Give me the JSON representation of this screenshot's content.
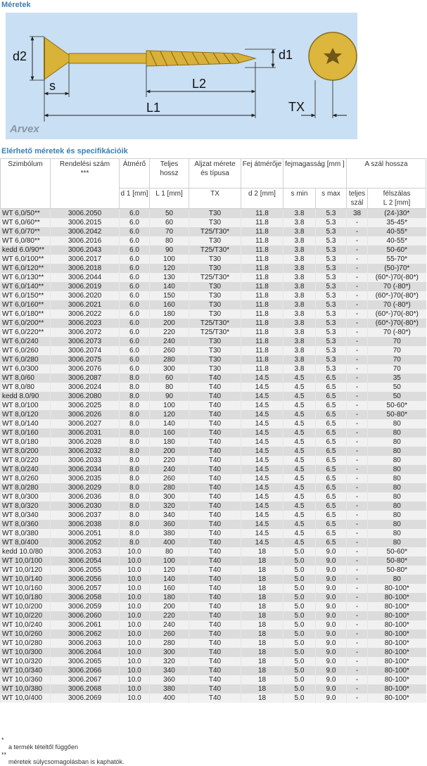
{
  "section_title": "Méretek",
  "spec_title": "Elérhető méretek és specifikációik",
  "diagram": {
    "labels": {
      "d2": "d2",
      "d1": "d1",
      "s": "s",
      "L2": "L2",
      "L1": "L1",
      "TX": "TX"
    },
    "brand": "Arvex"
  },
  "table": {
    "headers": {
      "symbol": "Szimbólum",
      "order": "Rendelési szám",
      "order_mark": "***",
      "diameter": "Átmérő",
      "length": "Teljes hossz",
      "socket": "Aljzat mérete és típusa",
      "head": "Fej átmérője",
      "head_height": "fejmagasság [mm ]",
      "thread": "A szál hossza",
      "full": "teljes szál",
      "partial": "félszálas",
      "d1": "d 1 [mm]",
      "l1": "L 1 [mm]",
      "tx": "TX",
      "d2": "d 2 [mm]",
      "smin": "s min",
      "smax": "s max",
      "l2": "L 2 [mm]"
    },
    "rows": [
      [
        "WT 6,0/50**",
        "3006.2050",
        "6.0",
        "50",
        "T30",
        "11.8",
        "3.8",
        "5.3",
        "38",
        "(24-)30*"
      ],
      [
        "WT 6,0/60**",
        "3006.2015",
        "6.0",
        "60",
        "T30",
        "11.8",
        "3.8",
        "5.3",
        "-",
        "35-45*"
      ],
      [
        "WT 6,0/70**",
        "3006.2042",
        "6.0",
        "70",
        "T25/T30*",
        "11.8",
        "3.8",
        "5.3",
        "-",
        "40-55*"
      ],
      [
        "WT 6,0/80**",
        "3006.2016",
        "6.0",
        "80",
        "T30",
        "11.8",
        "3.8",
        "5.3",
        "-",
        "40-55*"
      ],
      [
        "kedd 6.0/90**",
        "3006.2043",
        "6.0",
        "90",
        "T25/T30*",
        "11.8",
        "3.8",
        "5.3",
        "-",
        "50-60*"
      ],
      [
        "WT 6,0/100**",
        "3006.2017",
        "6.0",
        "100",
        "T30",
        "11.8",
        "3.8",
        "5.3",
        "-",
        "55-70*"
      ],
      [
        "WT 6,0/120**",
        "3006.2018",
        "6.0",
        "120",
        "T30",
        "11.8",
        "3.8",
        "5.3",
        "-",
        "(50-)70*"
      ],
      [
        "WT 6,0/130**",
        "3006.2044",
        "6.0",
        "130",
        "T25/T30*",
        "11.8",
        "3.8",
        "5.3",
        "-",
        "(60*-)70(-80*)"
      ],
      [
        "WT 6,0/140**",
        "3006.2019",
        "6.0",
        "140",
        "T30",
        "11.8",
        "3.8",
        "5.3",
        "-",
        "70 (-80*)"
      ],
      [
        "WT 6,0/150**",
        "3006.2020",
        "6.0",
        "150",
        "T30",
        "11.8",
        "3.8",
        "5.3",
        "-",
        "(60*-)70(-80*)"
      ],
      [
        "WT 6,0/160**",
        "3006.2021",
        "6.0",
        "160",
        "T30",
        "11.8",
        "3.8",
        "5.3",
        "-",
        "70 (-80*)"
      ],
      [
        "WT 6,0/180**",
        "3006.2022",
        "6.0",
        "180",
        "T30",
        "11.8",
        "3.8",
        "5.3",
        "-",
        "(60*-)70(-80*)"
      ],
      [
        "WT 6,0/200**",
        "3006.2023",
        "6.0",
        "200",
        "T25/T30*",
        "11.8",
        "3.8",
        "5.3",
        "-",
        "(60*-)70(-80*)"
      ],
      [
        "WT 6,0/220**",
        "3006.2072",
        "6.0",
        "220",
        "T25/T30*",
        "11.8",
        "3.8",
        "5.3",
        "-",
        "70 (-80*)"
      ],
      [
        "WT 6,0/240",
        "3006.2073",
        "6.0",
        "240",
        "T30",
        "11.8",
        "3.8",
        "5.3",
        "-",
        "70"
      ],
      [
        "WT 6,0/260",
        "3006.2074",
        "6.0",
        "260",
        "T30",
        "11.8",
        "3.8",
        "5.3",
        "-",
        "70"
      ],
      [
        "WT 6,0/280",
        "3006.2075",
        "6.0",
        "280",
        "T30",
        "11.8",
        "3.8",
        "5.3",
        "-",
        "70"
      ],
      [
        "WT 6,0/300",
        "3006.2076",
        "6.0",
        "300",
        "T30",
        "11.8",
        "3.8",
        "5.3",
        "-",
        "70"
      ],
      [
        "WT 8,0/60",
        "3006.2087",
        "8.0",
        "60",
        "T40",
        "14.5",
        "4.5",
        "6.5",
        "-",
        "35"
      ],
      [
        "WT 8,0/80",
        "3006.2024",
        "8.0",
        "80",
        "T40",
        "14.5",
        "4.5",
        "6.5",
        "-",
        "50"
      ],
      [
        "kedd 8.0/90",
        "3006.2080",
        "8.0",
        "90",
        "T40",
        "14.5",
        "4.5",
        "6.5",
        "-",
        "50"
      ],
      [
        "WT 8,0/100",
        "3006.2025",
        "8.0",
        "100",
        "T40",
        "14.5",
        "4.5",
        "6.5",
        "-",
        "50-60*"
      ],
      [
        "WT 8,0/120",
        "3006.2026",
        "8.0",
        "120",
        "T40",
        "14.5",
        "4.5",
        "6.5",
        "-",
        "50-80*"
      ],
      [
        "WT 8,0/140",
        "3006.2027",
        "8.0",
        "140",
        "T40",
        "14.5",
        "4.5",
        "6.5",
        "-",
        "80"
      ],
      [
        "WT 8,0/160",
        "3006.2031",
        "8.0",
        "160",
        "T40",
        "14.5",
        "4.5",
        "6.5",
        "-",
        "80"
      ],
      [
        "WT 8,0/180",
        "3006.2028",
        "8.0",
        "180",
        "T40",
        "14.5",
        "4.5",
        "6.5",
        "-",
        "80"
      ],
      [
        "WT 8,0/200",
        "3006.2032",
        "8.0",
        "200",
        "T40",
        "14.5",
        "4.5",
        "6.5",
        "-",
        "80"
      ],
      [
        "WT 8,0/220",
        "3006.2033",
        "8.0",
        "220",
        "T40",
        "14.5",
        "4.5",
        "6.5",
        "-",
        "80"
      ],
      [
        "WT 8,0/240",
        "3006.2034",
        "8.0",
        "240",
        "T40",
        "14.5",
        "4.5",
        "6.5",
        "-",
        "80"
      ],
      [
        "WT 8,0/260",
        "3006.2035",
        "8.0",
        "260",
        "T40",
        "14.5",
        "4.5",
        "6.5",
        "-",
        "80"
      ],
      [
        "WT 8,0/280",
        "3006.2029",
        "8.0",
        "280",
        "T40",
        "14.5",
        "4.5",
        "6.5",
        "-",
        "80"
      ],
      [
        "WT 8,0/300",
        "3006.2036",
        "8.0",
        "300",
        "T40",
        "14.5",
        "4.5",
        "6.5",
        "-",
        "80"
      ],
      [
        "WT 8,0/320",
        "3006.2030",
        "8.0",
        "320",
        "T40",
        "14.5",
        "4.5",
        "6.5",
        "-",
        "80"
      ],
      [
        "WT 8,0/340",
        "3006.2037",
        "8.0",
        "340",
        "T40",
        "14.5",
        "4.5",
        "6.5",
        "-",
        "80"
      ],
      [
        "WT 8,0/360",
        "3006.2038",
        "8.0",
        "360",
        "T40",
        "14.5",
        "4.5",
        "6.5",
        "-",
        "80"
      ],
      [
        "WT 8,0/380",
        "3006.2051",
        "8.0",
        "380",
        "T40",
        "14.5",
        "4.5",
        "6.5",
        "-",
        "80"
      ],
      [
        "WT 8,0/400",
        "3006.2052",
        "8.0",
        "400",
        "T40",
        "14.5",
        "4.5",
        "6.5",
        "-",
        "80"
      ],
      [
        "kedd 10.0/80",
        "3006.2053",
        "10.0",
        "80",
        "T40",
        "18",
        "5.0",
        "9.0",
        "-",
        "50-60*"
      ],
      [
        "WT 10,0/100",
        "3006.2054",
        "10.0",
        "100",
        "T40",
        "18",
        "5.0",
        "9.0",
        "-",
        "50-80*"
      ],
      [
        "WT 10,0/120",
        "3006.2055",
        "10.0",
        "120",
        "T40",
        "18",
        "5.0",
        "9.0",
        "-",
        "50-80*"
      ],
      [
        "WT 10,0/140",
        "3006.2056",
        "10.0",
        "140",
        "T40",
        "18",
        "5.0",
        "9.0",
        "-",
        "80"
      ],
      [
        "WT 10,0/160",
        "3006.2057",
        "10.0",
        "160",
        "T40",
        "18",
        "5.0",
        "9.0",
        "-",
        "80-100*"
      ],
      [
        "WT 10,0/180",
        "3006.2058",
        "10.0",
        "180",
        "T40",
        "18",
        "5.0",
        "9.0",
        "-",
        "80-100*"
      ],
      [
        "WT 10,0/200",
        "3006.2059",
        "10.0",
        "200",
        "T40",
        "18",
        "5.0",
        "9.0",
        "-",
        "80-100*"
      ],
      [
        "WT 10,0/220",
        "3006.2060",
        "10.0",
        "220",
        "T40",
        "18",
        "5.0",
        "9.0",
        "-",
        "80-100*"
      ],
      [
        "WT 10,0/240",
        "3006.2061",
        "10.0",
        "240",
        "T40",
        "18",
        "5.0",
        "9.0",
        "-",
        "80-100*"
      ],
      [
        "WT 10,0/260",
        "3006.2062",
        "10.0",
        "260",
        "T40",
        "18",
        "5.0",
        "9.0",
        "-",
        "80-100*"
      ],
      [
        "WT 10,0/280",
        "3006.2063",
        "10.0",
        "280",
        "T40",
        "18",
        "5.0",
        "9.0",
        "-",
        "80-100*"
      ],
      [
        "WT 10,0/300",
        "3006.2064",
        "10.0",
        "300",
        "T40",
        "18",
        "5.0",
        "9.0",
        "-",
        "80-100*"
      ],
      [
        "WT 10,0/320",
        "3006.2065",
        "10.0",
        "320",
        "T40",
        "18",
        "5.0",
        "9.0",
        "-",
        "80-100*"
      ],
      [
        "WT 10,0/340",
        "3006.2066",
        "10.0",
        "340",
        "T40",
        "18",
        "5.0",
        "9.0",
        "-",
        "80-100*"
      ],
      [
        "WT 10,0/360",
        "3006.2067",
        "10.0",
        "360",
        "T40",
        "18",
        "5.0",
        "9.0",
        "-",
        "80-100*"
      ],
      [
        "WT 10,0/380",
        "3006.2068",
        "10.0",
        "380",
        "T40",
        "18",
        "5.0",
        "9.0",
        "-",
        "80-100*"
      ],
      [
        "WT 10,0/400",
        "3006.2069",
        "10.0",
        "400",
        "T40",
        "18",
        "5.0",
        "9.0",
        "-",
        "80-100*"
      ]
    ]
  },
  "footnotes": [
    {
      "mark": "*",
      "text": "a termék tételtől függően"
    },
    {
      "mark": "**",
      "text": "méretek súlycsomagolásban is kaphatók."
    }
  ]
}
